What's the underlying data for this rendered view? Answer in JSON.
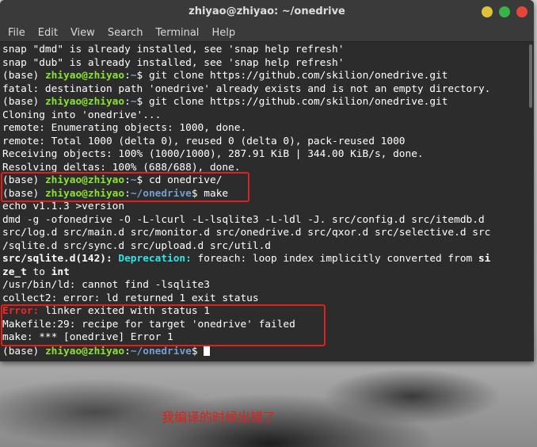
{
  "window": {
    "title": "zhiyao@zhiyao: ~/onedrive"
  },
  "menu": [
    "File",
    "Edit",
    "View",
    "Search",
    "Terminal",
    "Help"
  ],
  "terminal": {
    "lines": [
      {
        "segs": [
          {
            "t": "snap \"dmd\" is already installed, see 'snap help refresh'"
          }
        ]
      },
      {
        "segs": [
          {
            "t": "snap \"dub\" is already installed, see 'snap help refresh'"
          }
        ]
      },
      {
        "segs": [
          {
            "t": "(base) "
          },
          {
            "t": "zhiyao@zhiyao",
            "c": "g"
          },
          {
            "t": ":"
          },
          {
            "t": "~",
            "c": "b"
          },
          {
            "t": "$ git clone https://github.com/skilion/onedrive.git"
          }
        ]
      },
      {
        "segs": [
          {
            "t": "fatal: destination path 'onedrive' already exists and is not an empty directory."
          }
        ]
      },
      {
        "segs": [
          {
            "t": "(base) "
          },
          {
            "t": "zhiyao@zhiyao",
            "c": "g"
          },
          {
            "t": ":"
          },
          {
            "t": "~",
            "c": "b"
          },
          {
            "t": "$ git clone https://github.com/skilion/onedrive.git"
          }
        ]
      },
      {
        "segs": [
          {
            "t": "Cloning into 'onedrive'..."
          }
        ]
      },
      {
        "segs": [
          {
            "t": "remote: Enumerating objects: 1000, done."
          }
        ]
      },
      {
        "segs": [
          {
            "t": "remote: Total 1000 (delta 0), reused 0 (delta 0), pack-reused 1000"
          }
        ]
      },
      {
        "segs": [
          {
            "t": "Receiving objects: 100% (1000/1000), 287.91 KiB | 344.00 KiB/s, done."
          }
        ]
      },
      {
        "segs": [
          {
            "t": "Resolving deltas: 100% (688/688), done."
          }
        ]
      },
      {
        "segs": [
          {
            "t": "(base) "
          },
          {
            "t": "zhiyao@zhiyao",
            "c": "g"
          },
          {
            "t": ":"
          },
          {
            "t": "~",
            "c": "b"
          },
          {
            "t": "$ cd onedrive/"
          }
        ]
      },
      {
        "segs": [
          {
            "t": "(base) "
          },
          {
            "t": "zhiyao@zhiyao",
            "c": "g"
          },
          {
            "t": ":"
          },
          {
            "t": "~/onedrive",
            "c": "b"
          },
          {
            "t": "$ make"
          }
        ]
      },
      {
        "segs": [
          {
            "t": "echo v1.1.3 >version"
          }
        ]
      },
      {
        "segs": [
          {
            "t": "dmd -g -ofonedrive -O -L-lcurl -L-lsqlite3 -L-ldl -J. src/config.d src/itemdb.d "
          }
        ]
      },
      {
        "segs": [
          {
            "t": "src/log.d src/main.d src/monitor.d src/onedrive.d src/qxor.d src/selective.d src"
          }
        ]
      },
      {
        "segs": [
          {
            "t": "/sqlite.d src/sync.d src/upload.d src/util.d"
          }
        ]
      },
      {
        "segs": [
          {
            "t": "src/sqlite.d(142): ",
            "c": "bold"
          },
          {
            "t": "Deprecation:",
            "c": "cy"
          },
          {
            "t": " foreach: loop index implicitly converted from "
          },
          {
            "t": "si",
            "c": "bold"
          }
        ]
      },
      {
        "segs": [
          {
            "t": "ze_t",
            "c": "bold"
          },
          {
            "t": " to "
          },
          {
            "t": "int",
            "c": "bold"
          }
        ]
      },
      {
        "segs": [
          {
            "t": "/usr/bin/ld: cannot find -lsqlite3"
          }
        ]
      },
      {
        "segs": [
          {
            "t": "collect2: error: ld returned 1 exit status"
          }
        ]
      },
      {
        "segs": [
          {
            "t": "Error:",
            "c": "red"
          },
          {
            "t": " linker exited with status 1"
          }
        ]
      },
      {
        "segs": [
          {
            "t": "Makefile:29: recipe for target 'onedrive' failed"
          }
        ]
      },
      {
        "segs": [
          {
            "t": "make: *** [onedrive] Error 1"
          }
        ]
      },
      {
        "segs": [
          {
            "t": "(base) "
          },
          {
            "t": "zhiyao@zhiyao",
            "c": "g"
          },
          {
            "t": ":"
          },
          {
            "t": "~/onedrive",
            "c": "b"
          },
          {
            "t": "$ "
          }
        ],
        "cursor": true
      }
    ]
  },
  "annotation": {
    "caption": "我编译的时候出错了",
    "color": "#e0201a"
  }
}
